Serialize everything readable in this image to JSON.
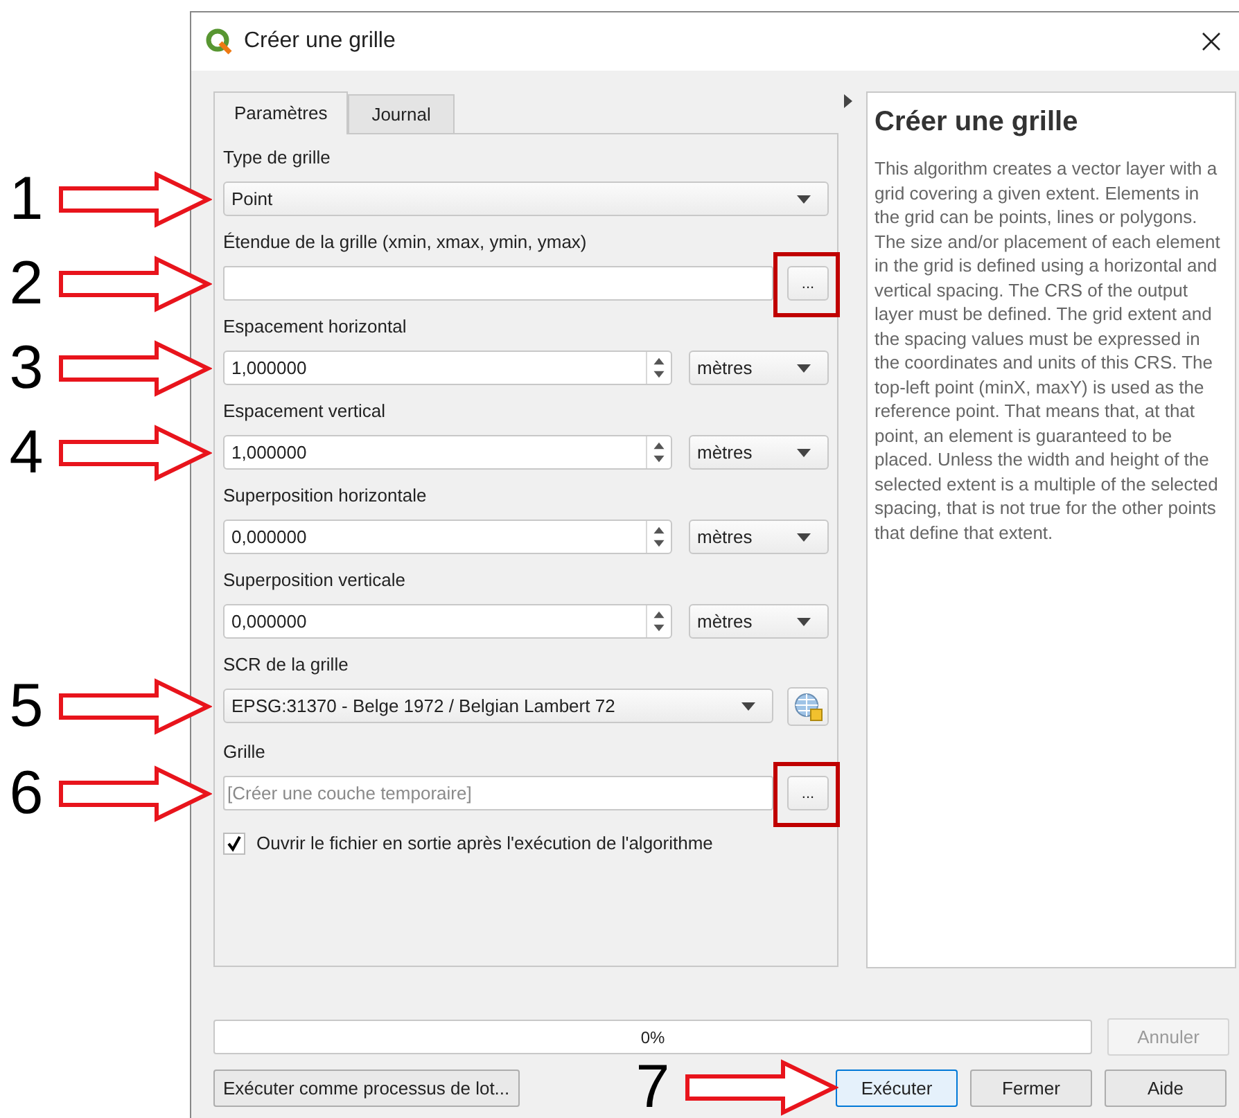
{
  "window": {
    "title": "Créer une grille"
  },
  "tabs": [
    {
      "label": "Paramètres",
      "selected": true
    },
    {
      "label": "Journal",
      "selected": false
    }
  ],
  "parameters": [
    {
      "kind": "combo",
      "label": "Type de grille",
      "value": "Point",
      "annotation": "1"
    },
    {
      "kind": "file",
      "label": "Étendue de la grille (xmin, xmax, ymin, ymax)",
      "button": "...",
      "highlighted": true,
      "annotation": "2"
    },
    {
      "kind": "spin",
      "label": "Espacement horizontal",
      "value": "1,000000",
      "unit": "mètres",
      "annotation": "3"
    },
    {
      "kind": "spin",
      "label": "Espacement vertical",
      "value": "1,000000",
      "unit": "mètres",
      "annotation": "4"
    },
    {
      "kind": "spin",
      "label": "Superposition horizontale",
      "value": "0,000000",
      "unit": "mètres"
    },
    {
      "kind": "spin",
      "label": "Superposition verticale",
      "value": "0,000000",
      "unit": "mètres"
    },
    {
      "kind": "crs",
      "label": "SCR de la grille",
      "value": "EPSG:31370 - Belge 1972 / Belgian Lambert 72",
      "annotation": "5"
    },
    {
      "kind": "file",
      "label": "Grille",
      "placeholder": "[Créer une couche temporaire]",
      "button": "...",
      "highlighted": true,
      "annotation": "6"
    },
    {
      "kind": "checkbox",
      "label": "Ouvrir le fichier en sortie après l'exécution de l'algorithme",
      "checked": true
    }
  ],
  "help": {
    "title": "Créer une grille",
    "text": "This algorithm creates a vector layer with a grid covering a given extent. Elements in the grid can be points, lines or polygons. The size and/or placement of each element in the grid is defined using a horizontal and vertical spacing. The CRS of the output layer must be defined. The grid extent and the spacing values must be expressed in the coordinates and units of this CRS. The top-left point (minX, maxY) is used as the reference point. That means that, at that point, an element is guaranteed to be placed. Unless the width and height of the selected extent is a multiple of the selected spacing, that is not true for the other points that define that extent."
  },
  "progress": {
    "level": 0,
    "reading": "0%"
  },
  "cancel": {
    "label": "Annuler",
    "disabled": true
  },
  "batch_button": {
    "label": "Exécuter comme processus de lot..."
  },
  "buttons": [
    {
      "label": "Exécuter",
      "default": true,
      "annotation": "7"
    },
    {
      "label": "Fermer",
      "default": false
    },
    {
      "label": "Aide",
      "default": false
    }
  ]
}
